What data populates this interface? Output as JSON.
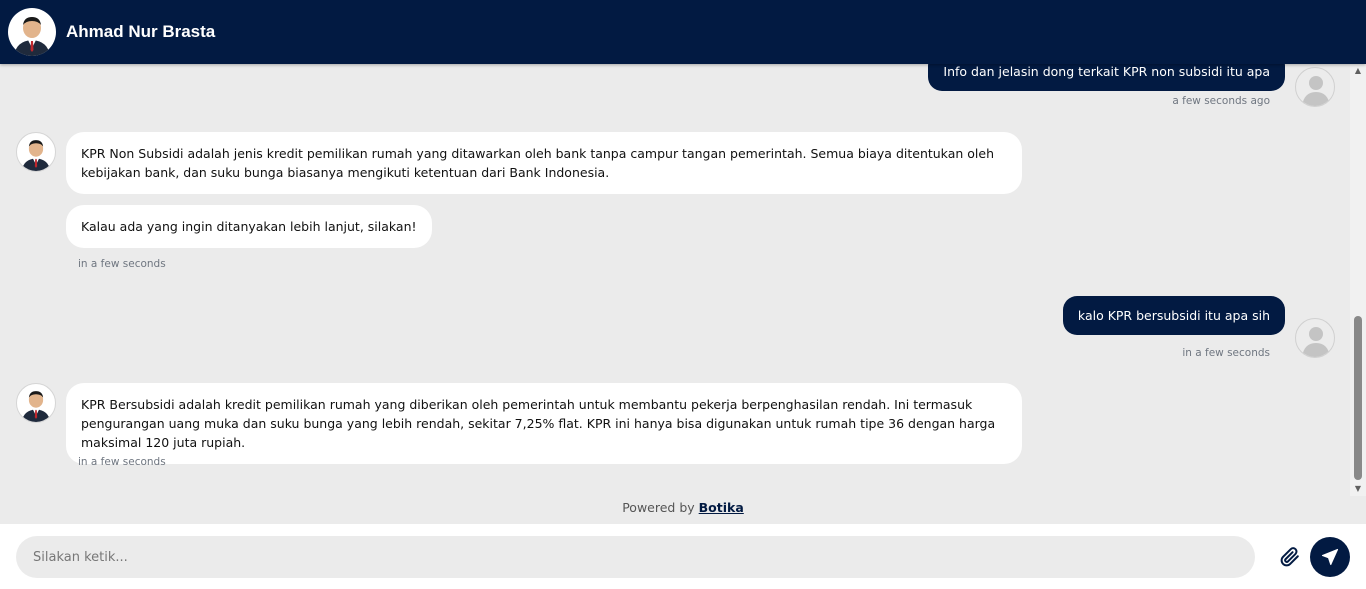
{
  "header": {
    "name": "Ahmad Nur Brasta"
  },
  "messages": [
    {
      "from": "user",
      "text": "Info dan jelasin dong terkait KPR non subsidi itu apa",
      "time": "a few seconds ago"
    },
    {
      "from": "bot",
      "texts": [
        "KPR Non Subsidi adalah jenis kredit pemilikan rumah yang ditawarkan oleh bank tanpa campur tangan pemerintah. Semua biaya ditentukan oleh kebijakan bank, dan suku bunga biasanya mengikuti ketentuan dari Bank Indonesia.",
        "Kalau ada yang ingin ditanyakan lebih lanjut, silakan!"
      ],
      "time": "in a few seconds"
    },
    {
      "from": "user",
      "text": "kalo KPR bersubsidi itu apa sih",
      "time": "in a few seconds"
    },
    {
      "from": "bot",
      "texts": [
        "KPR Bersubsidi adalah kredit pemilikan rumah yang diberikan oleh pemerintah untuk membantu pekerja berpenghasilan rendah. Ini termasuk pengurangan uang muka dan suku bunga yang lebih rendah, sekitar 7,25% flat. KPR ini hanya bisa digunakan untuk rumah tipe 36 dengan harga maksimal 120 juta rupiah."
      ],
      "time": "in a few seconds"
    }
  ],
  "footer": {
    "powered_prefix": "Powered by",
    "powered_brand": "Botika",
    "placeholder": "Silakan ketik..."
  },
  "colors": {
    "primary": "#021a42",
    "background": "#ebebeb"
  }
}
